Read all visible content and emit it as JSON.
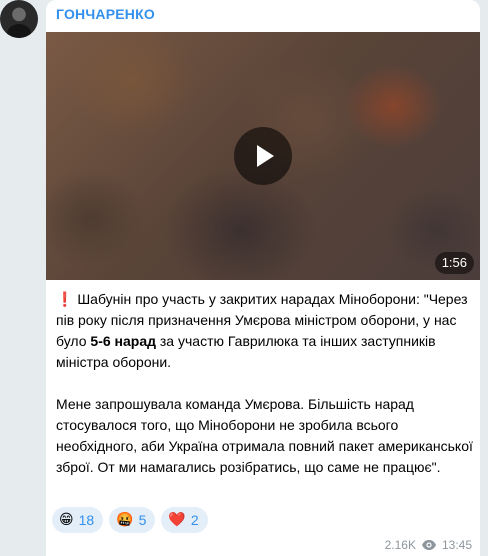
{
  "channel": {
    "name": "ГОНЧАРЕНКО"
  },
  "video": {
    "duration": "1:56",
    "play_icon": "play-icon"
  },
  "message": {
    "paragraph1_prefix": "Шабунін про участь у закритих нарадах Міноборони: \"Через пів року після призначення Умєрова міністром оборони, у нас було ",
    "paragraph1_bold": "5-6 нарад",
    "paragraph1_suffix": " за участю Гаврилюка та інших заступників міністра оборони.",
    "paragraph2": "Мене запрошувала команда Умєрова. Більшість нарад стосувалося того, що Міноборони не зробила всього необхідного, аби Україна отримала повний пакет американської зброї. От ми намагались розібратись, що саме не працює\".",
    "leading_emoji": "❗"
  },
  "reactions": [
    {
      "emoji": "😁",
      "count": "18"
    },
    {
      "emoji": "🤬",
      "count": "5"
    },
    {
      "emoji": "❤️",
      "count": "2"
    }
  ],
  "footer": {
    "views": "2.16K",
    "time": "13:45",
    "views_icon": "eye-icon"
  },
  "colors": {
    "accent": "#3390ec",
    "background": "#e6ebee",
    "bubble": "#ffffff",
    "reaction_bg": "#e3eef9",
    "meta": "#8d969c"
  }
}
